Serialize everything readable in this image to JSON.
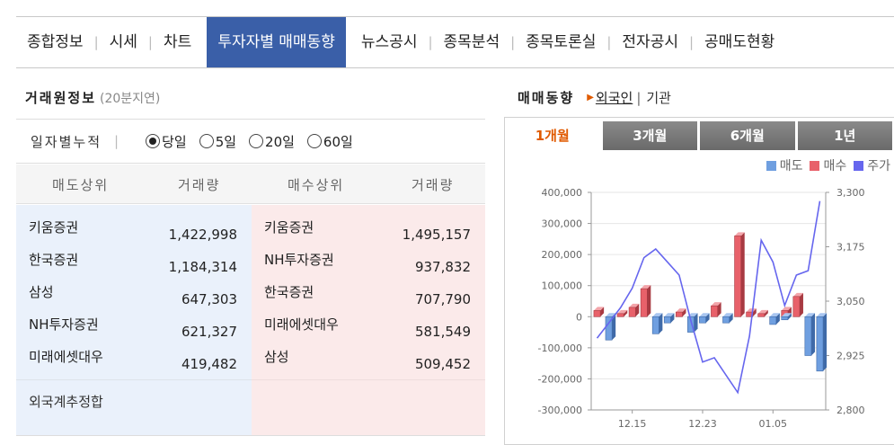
{
  "top_tabs": [
    {
      "label": "종합정보"
    },
    {
      "label": "시세"
    },
    {
      "label": "차트"
    },
    {
      "label": "투자자별 매매동향"
    },
    {
      "label": "뉴스공시"
    },
    {
      "label": "종목분석"
    },
    {
      "label": "종목토론실"
    },
    {
      "label": "전자공시"
    },
    {
      "label": "공매도현황"
    }
  ],
  "active_top_tab": 3,
  "broker_info": {
    "title": "거래원정보",
    "delay_note": "(20분지연)",
    "filter_label": "일자별누적",
    "options": [
      "당일",
      "5일",
      "20일",
      "60일"
    ],
    "selected_option": 0,
    "headers": {
      "sell_top": "매도상위",
      "sell_vol": "거래량",
      "buy_top": "매수상위",
      "buy_vol": "거래량"
    },
    "sell": [
      {
        "name": "키움증권",
        "volume": "1,422,998"
      },
      {
        "name": "한국증권",
        "volume": "1,184,314"
      },
      {
        "name": "삼성",
        "volume": "647,303"
      },
      {
        "name": "NH투자증권",
        "volume": "621,327"
      },
      {
        "name": "미래에셋대우",
        "volume": "419,482"
      }
    ],
    "buy": [
      {
        "name": "키움증권",
        "volume": "1,495,157"
      },
      {
        "name": "NH투자증권",
        "volume": "937,832"
      },
      {
        "name": "한국증권",
        "volume": "707,790"
      },
      {
        "name": "미래에셋대우",
        "volume": "581,549"
      },
      {
        "name": "삼성",
        "volume": "509,452"
      }
    ],
    "foreign_label": "외국계추정합"
  },
  "trading_trend": {
    "title": "매매동향",
    "option_selected": "외국인",
    "option_other": "기관",
    "period_tabs": [
      "1개월",
      "3개월",
      "6개월",
      "1년"
    ],
    "active_period": 0
  },
  "chart_data": {
    "type": "bar",
    "legend": [
      "매도",
      "매수",
      "주가"
    ],
    "colors": {
      "sell": "#6f9fe0",
      "buy": "#e8616a",
      "price": "#6666ee"
    },
    "x_tick_labels": [
      "12.15",
      "12.23",
      "01.05"
    ],
    "x_tick_indices": [
      3,
      9,
      15
    ],
    "y_left_ticks": [
      "400,000",
      "300,000",
      "200,000",
      "100,000",
      "0",
      "-100,000",
      "-200,000",
      "-300,000"
    ],
    "y_left_range": [
      -300000,
      400000
    ],
    "y_right_ticks": [
      "3,300",
      "3,175",
      "3,050",
      "2,925",
      "2,800"
    ],
    "y_right_range": [
      2800,
      3300
    ],
    "series": [
      {
        "name": "매도",
        "values": [
          0,
          -75000,
          0,
          0,
          0,
          -55000,
          -20000,
          0,
          -50000,
          -20000,
          0,
          -20000,
          0,
          0,
          0,
          -25000,
          -10000,
          0,
          -125000,
          -175000
        ]
      },
      {
        "name": "매수",
        "values": [
          20000,
          0,
          10000,
          30000,
          90000,
          0,
          0,
          15000,
          0,
          0,
          35000,
          0,
          260000,
          15000,
          10000,
          0,
          20000,
          65000,
          0,
          0
        ]
      },
      {
        "name": "주가",
        "values": [
          2965,
          3000,
          3035,
          3080,
          3150,
          3170,
          3140,
          3110,
          3005,
          2910,
          2920,
          2880,
          2840,
          2970,
          3190,
          3140,
          3040,
          3110,
          3120,
          3280
        ]
      }
    ]
  }
}
